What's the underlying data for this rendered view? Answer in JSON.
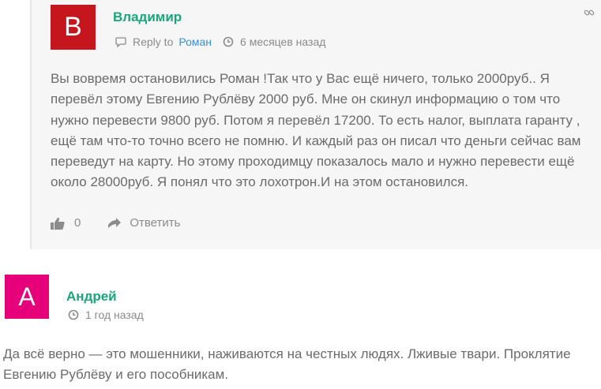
{
  "reply_comment": {
    "avatar_letter": "B",
    "author": "Владимир",
    "reply_to_prefix": "Reply to",
    "reply_to_name": "Роман",
    "time": "6 месяцев назад",
    "text": "Вы вовремя остановились Роман !Так что у Вас ещё ничего, только 2000руб.. Я перевёл этому Евгению Рублёву 2000 руб. Мне он скинул информацию о том что нужно перевести 9800 руб. Потом я перевёл 17200. То есть налог, выплата гаранту , ещё там что-то точно всего не помню. И каждый раз он писал что деньги сейчас вам переведут на карту. Но этому проходимцу показалось мало и нужно перевести ещё около 28000руб. Я понял что это лохотрон.И на этом остановился.",
    "likes": "0",
    "reply_button": "Ответить",
    "avatar_color": "#c4161c"
  },
  "comment": {
    "avatar_letter": "А",
    "author": "Андрей",
    "time": "1 год назад",
    "text": "Да всё верно — это мошенники, наживаются на честных людях. Лживые твари. Проклятие Евгению Рублёву и его пособникам.",
    "avatar_color": "#e6007a"
  },
  "colors": {
    "author": "#1aa67a",
    "link": "#3a8fd6",
    "text": "#6b6b6b",
    "meta": "#8b8b8b"
  },
  "icons": [
    "link-icon",
    "reply-bubble-icon",
    "clock-icon",
    "thumbs-up-icon",
    "reply-arrow-icon"
  ]
}
